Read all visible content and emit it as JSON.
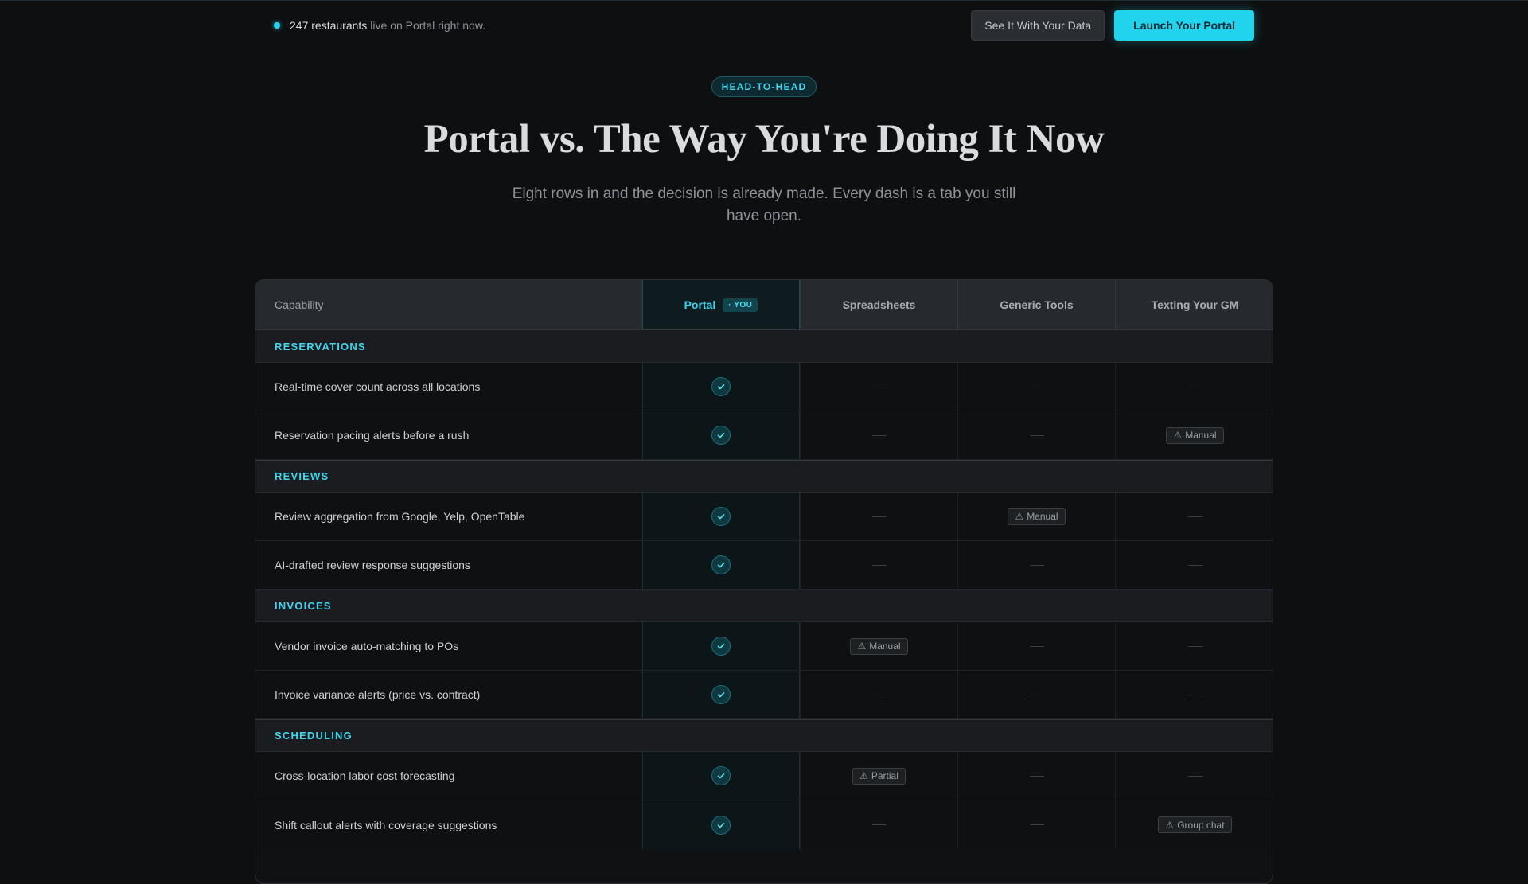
{
  "topbar": {
    "status_count": "247 restaurants",
    "status_text": "live on Portal right now.",
    "secondary_button": "See It With Your Data",
    "primary_button": "Launch Your Portal"
  },
  "hero": {
    "eyebrow": "HEAD-TO-HEAD",
    "title": "Portal vs. The Way You're Doing It Now",
    "subtitle": "Eight rows in and the decision is already made. Every dash is a tab you still have open."
  },
  "table": {
    "headers": {
      "capability": "Capability",
      "portal": "Portal",
      "portal_badge": "· YOU",
      "spreadsheets": "Spreadsheets",
      "generic_tools": "Generic Tools",
      "texting_gm": "Texting Your GM"
    },
    "sections": [
      {
        "title": "RESERVATIONS",
        "rows": [
          {
            "label": "Real-time cover count across all locations",
            "portal": "check",
            "spreadsheets": "dash",
            "generic_tools": "dash",
            "texting_gm": "dash"
          },
          {
            "label": "Reservation pacing alerts before a rush",
            "portal": "check",
            "spreadsheets": "dash",
            "generic_tools": "dash",
            "texting_gm": "Manual"
          }
        ]
      },
      {
        "title": "REVIEWS",
        "rows": [
          {
            "label": "Review aggregation from Google, Yelp, OpenTable",
            "portal": "check",
            "spreadsheets": "dash",
            "generic_tools": "Manual",
            "texting_gm": "dash"
          },
          {
            "label": "AI-drafted review response suggestions",
            "portal": "check",
            "spreadsheets": "dash",
            "generic_tools": "dash",
            "texting_gm": "dash"
          }
        ]
      },
      {
        "title": "INVOICES",
        "rows": [
          {
            "label": "Vendor invoice auto-matching to POs",
            "portal": "check",
            "spreadsheets": "Manual",
            "generic_tools": "dash",
            "texting_gm": "dash"
          },
          {
            "label": "Invoice variance alerts (price vs. contract)",
            "portal": "check",
            "spreadsheets": "dash",
            "generic_tools": "dash",
            "texting_gm": "dash"
          }
        ]
      },
      {
        "title": "SCHEDULING",
        "rows": [
          {
            "label": "Cross-location labor cost forecasting",
            "portal": "check",
            "spreadsheets": "Partial",
            "generic_tools": "dash",
            "texting_gm": "dash"
          },
          {
            "label": "Shift callout alerts with coverage suggestions",
            "portal": "check",
            "spreadsheets": "dash",
            "generic_tools": "dash",
            "texting_gm": "Group chat"
          }
        ]
      }
    ]
  },
  "icons": {
    "status_dot": "status-dot-icon",
    "check": "check-icon",
    "warning": "warning-icon",
    "dash": "dash-icon"
  },
  "colors": {
    "background": "#0e0f11",
    "accent": "#22d3ee",
    "check_bg": "#0f3941"
  }
}
